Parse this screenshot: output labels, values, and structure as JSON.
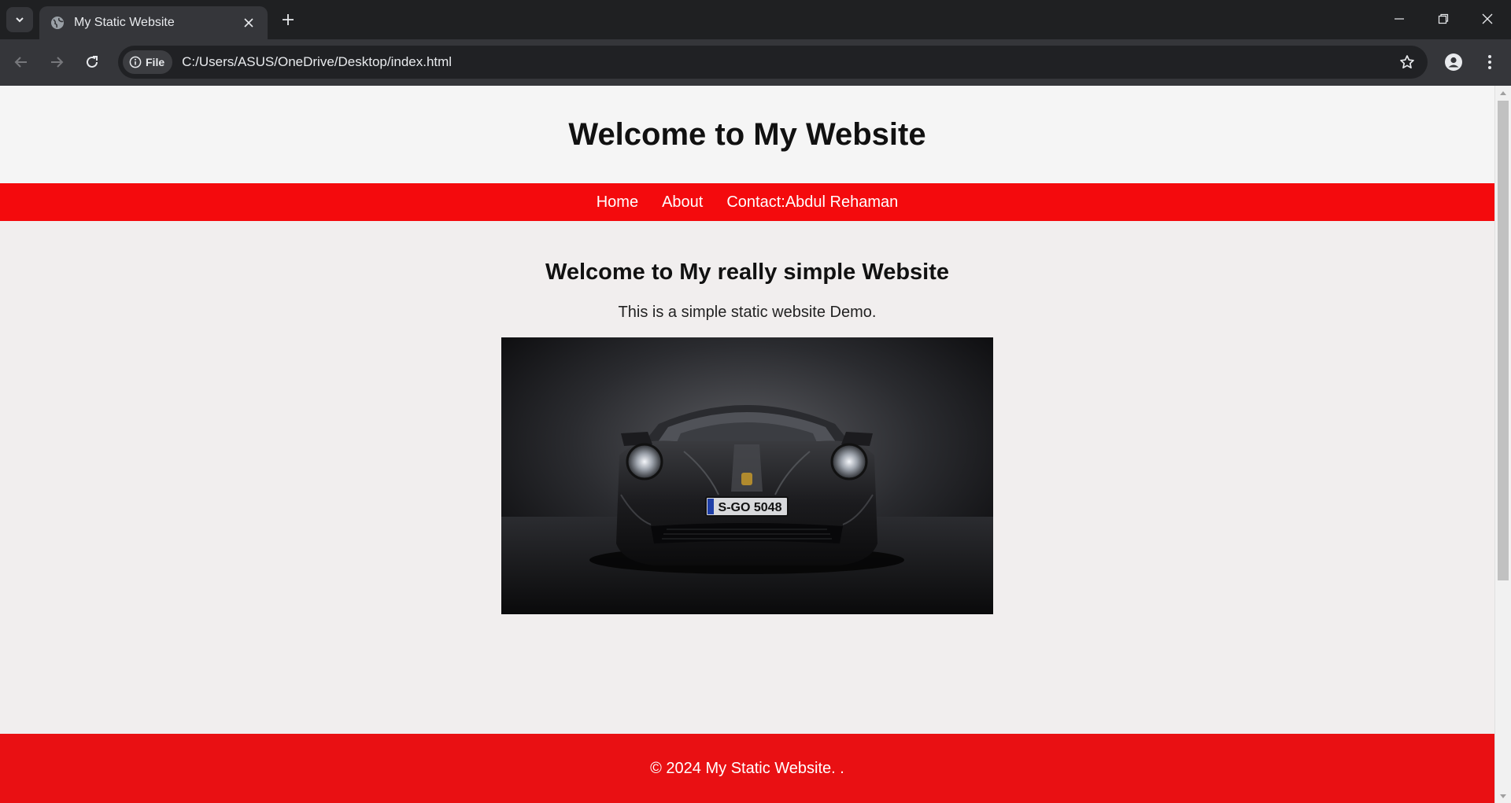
{
  "browser": {
    "tab": {
      "title": "My Static Website"
    },
    "address_bar": {
      "scheme_chip": "File",
      "url": "C:/Users/ASUS/OneDrive/Desktop/index.html"
    }
  },
  "site": {
    "header_title": "Welcome to My Website",
    "nav": [
      {
        "label": "Home"
      },
      {
        "label": "About"
      },
      {
        "label": "Contact:Abdul Rehaman"
      }
    ],
    "main": {
      "heading": "Welcome to My really simple Website",
      "paragraph": "This is a simple static website Demo.",
      "image": {
        "plate_text": "S-GO 5048"
      }
    },
    "footer_text": "© 2024 My Static Website. ."
  },
  "colors": {
    "nav_bg": "#f40a0d",
    "footer_bg": "#e91013",
    "page_bg": "#f1eeee",
    "header_bg": "#f5f5f5",
    "chrome_dark": "#1f2022"
  }
}
